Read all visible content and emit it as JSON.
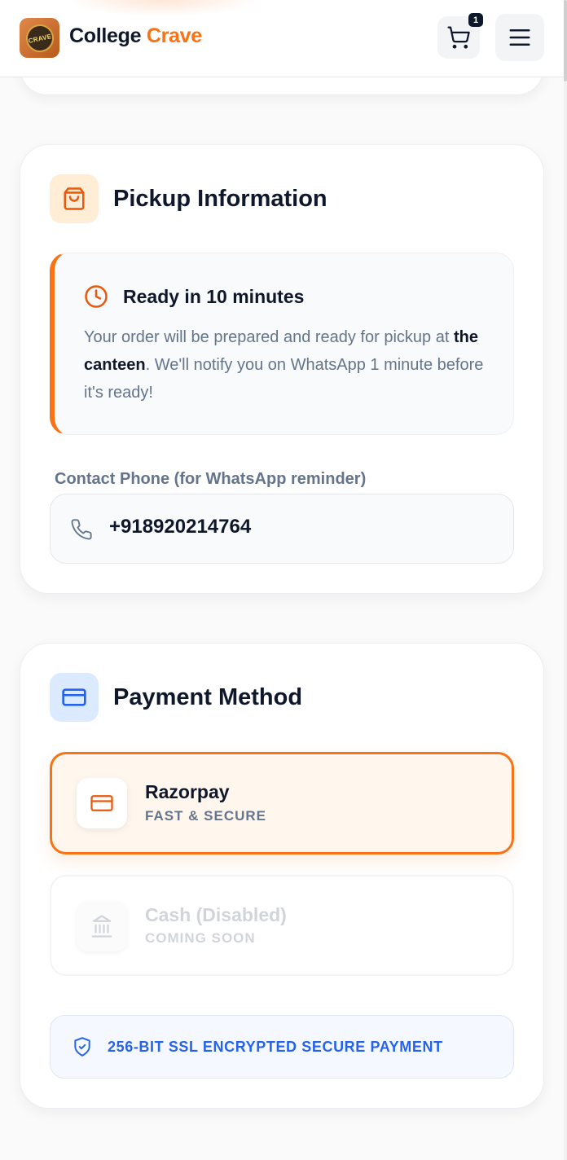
{
  "header": {
    "brand_part1": "College",
    "brand_part2": "Crave",
    "logo_text": "CRAVE",
    "cart_count": "1",
    "cart_icon": "shopping-cart-icon",
    "menu_icon": "hamburger-menu-icon"
  },
  "pickup": {
    "title": "Pickup Information",
    "icon": "shopping-bag-icon",
    "ready_title": "Ready in 10 minutes",
    "ready_text_1": "Your order will be prepared and ready for pickup at ",
    "ready_text_bold": "the canteen",
    "ready_text_2": ". We'll notify you on WhatsApp 1 minute before it's ready!",
    "phone_label": "Contact Phone (for WhatsApp reminder)",
    "phone_value": "+918920214764"
  },
  "payment": {
    "title": "Payment Method",
    "icon": "credit-card-icon",
    "options": [
      {
        "name": "Razorpay",
        "sub": "FAST & SECURE",
        "selected": true,
        "icon": "credit-card-icon"
      },
      {
        "name": "Cash (Disabled)",
        "sub": "COMING SOON",
        "selected": false,
        "icon": "bank-icon"
      }
    ],
    "ssl_text": "256-BIT SSL ENCRYPTED SECURE PAYMENT"
  },
  "colors": {
    "accent": "#f97316",
    "text_dark": "#0f172a",
    "text_muted": "#64748b",
    "secure_blue": "#2563eb"
  }
}
